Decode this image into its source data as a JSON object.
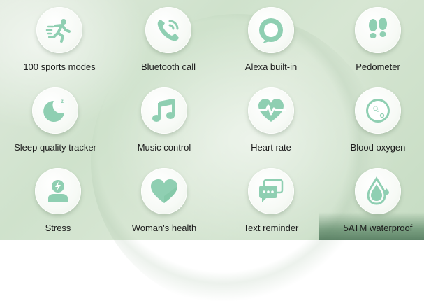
{
  "accent_color": "#8fcfb2",
  "features": [
    {
      "label": "100 sports modes",
      "icon": "running-person-icon"
    },
    {
      "label": "Bluetooth call",
      "icon": "phone-call-icon"
    },
    {
      "label": "Alexa built-in",
      "icon": "alexa-ring-icon"
    },
    {
      "label": "Pedometer",
      "icon": "footprints-icon"
    },
    {
      "label": "Sleep quality tracker",
      "icon": "moon-zzz-icon"
    },
    {
      "label": "Music control",
      "icon": "music-note-icon"
    },
    {
      "label": "Heart rate",
      "icon": "heart-pulse-icon"
    },
    {
      "label": "Blood oxygen",
      "icon": "o2-drop-icon"
    },
    {
      "label": "Stress",
      "icon": "stress-person-icon"
    },
    {
      "label": "Woman's health",
      "icon": "heart-icon"
    },
    {
      "label": "Text reminder",
      "icon": "chat-bubbles-icon"
    },
    {
      "label": "5ATM waterproof",
      "icon": "water-drop-icon"
    }
  ]
}
